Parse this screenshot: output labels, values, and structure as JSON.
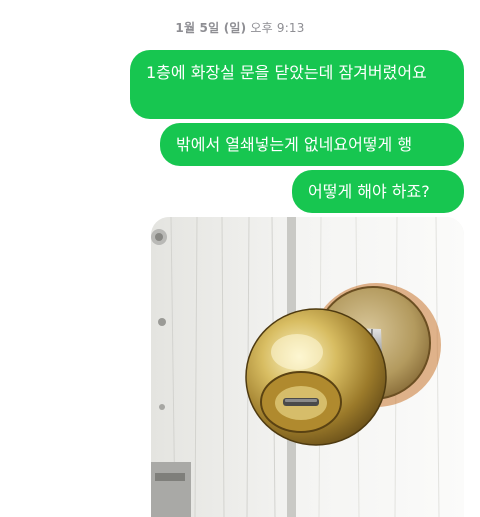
{
  "thread": {
    "timestamp_date": "1월 5일 (일)",
    "timestamp_time": "오후 9:13"
  },
  "messages": [
    {
      "text": "1층에 화장실 문을 닫았는데 잠겨버렸어요"
    },
    {
      "text": "밖에서 열쇄넣는게 없네요어떻게 행"
    },
    {
      "text": "어떻게 해야 하죠?"
    }
  ],
  "attachment": {
    "type": "photo"
  },
  "colors": {
    "bubble": "#17c650",
    "bubble_text": "#ffffff",
    "timestamp": "#8e8e93"
  }
}
